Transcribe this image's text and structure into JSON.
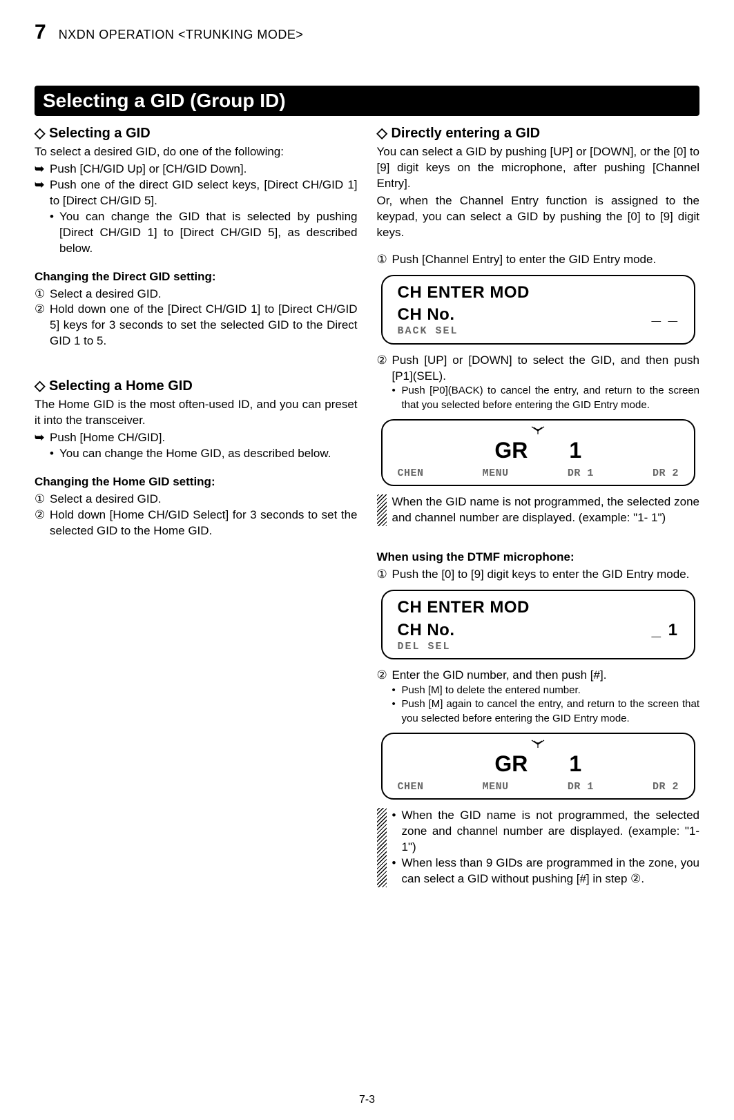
{
  "header": {
    "chapter_num": "7",
    "chapter_title": "NXDN OPERATION <TRUNKING MODE>"
  },
  "section_title": "Selecting a GID (Group ID)",
  "left": {
    "h1": "◇ Selecting a GID",
    "intro": "To select a desired GID, do one of the following:",
    "a1": "Push [CH/GID Up] or [CH/GID Down].",
    "a2": "Push one of the direct GID select keys, [Direct CH/GID 1] to [Direct CH/GID 5].",
    "a2b": "You can change the GID that is selected by pushing [Direct CH/GID 1] to [Direct CH/GID 5], as described below.",
    "chg1_title": "Changing the Direct GID setting:",
    "chg1_1": "Select a desired GID.",
    "chg1_2": "Hold down one of the [Direct CH/GID 1] to [Direct CH/GID 5] keys for 3 seconds to set the selected GID to the Direct GID 1 to 5.",
    "h2": "◇ Selecting a Home GID",
    "home_intro1": "The Home GID is the most often-used ID, and you can preset it into the transceiver.",
    "home_a1": "Push [Home CH/GID].",
    "home_a1b": "You can change the Home GID, as described below.",
    "chg2_title": "Changing the Home GID setting:",
    "chg2_1": "Select a desired GID.",
    "chg2_2": "Hold down [Home CH/GID Select] for 3 seconds to set the selected GID to the Home GID."
  },
  "right": {
    "h1": "◇ Directly entering a GID",
    "intro1": "You can select a GID by pushing [UP] or [DOWN], or the [0] to [9] digit keys on the microphone, after pushing [Channel Entry].",
    "intro2": "Or, when the Channel Entry function is assigned to the keypad, you can select a GID by pushing the [0] to [9] digit keys.",
    "s1": "Push [Channel Entry] to enter the GID Entry mode.",
    "lcd1": {
      "l1": "CH ENTER MOD",
      "l2a": "CH No.",
      "l2b": "_ _",
      "soft": "BACK   SEL"
    },
    "s2": "Push [UP] or [DOWN] to select the GID, and then push [P1](SEL).",
    "s2b": "Push [P0](BACK) to cancel the entry, and return to the screen that you selected before entering the GID Entry mode.",
    "lcd2": {
      "main_l": "GR",
      "main_r": "1",
      "soft_items": [
        "CHEN",
        "MENU",
        "DR 1",
        "DR 2"
      ]
    },
    "hatch1": "When the GID name is not programmed, the selected zone and channel number are displayed. (example: \"1-  1\")",
    "dtmf_title": "When using the DTMF microphone:",
    "d1": "Push the [0] to [9] digit keys to enter the GID Entry mode.",
    "lcd3": {
      "l1": "CH ENTER MOD",
      "l2a": "CH No.",
      "l2b": "_ 1",
      "soft": "DEL    SEL"
    },
    "d2": "Enter the GID number, and then push [#].",
    "d2b1": "Push [M] to delete the entered number.",
    "d2b2": "Push [M] again to cancel the entry, and return to the screen that you selected before entering the GID Entry mode.",
    "lcd4": {
      "main_l": "GR",
      "main_r": "1",
      "soft_items": [
        "CHEN",
        "MENU",
        "DR 1",
        "DR 2"
      ]
    },
    "hatch2a": "When the GID name is not programmed, the selected zone and channel number are displayed. (example: \"1-  1\")",
    "hatch2b": "When less than 9 GIDs are programmed in the zone, you can select a GID without pushing [#] in step ②."
  },
  "footer": "7-3",
  "glyphs": {
    "arrow": "➥",
    "bullet": "•",
    "c1": "①",
    "c2": "②",
    "star": "M"
  }
}
